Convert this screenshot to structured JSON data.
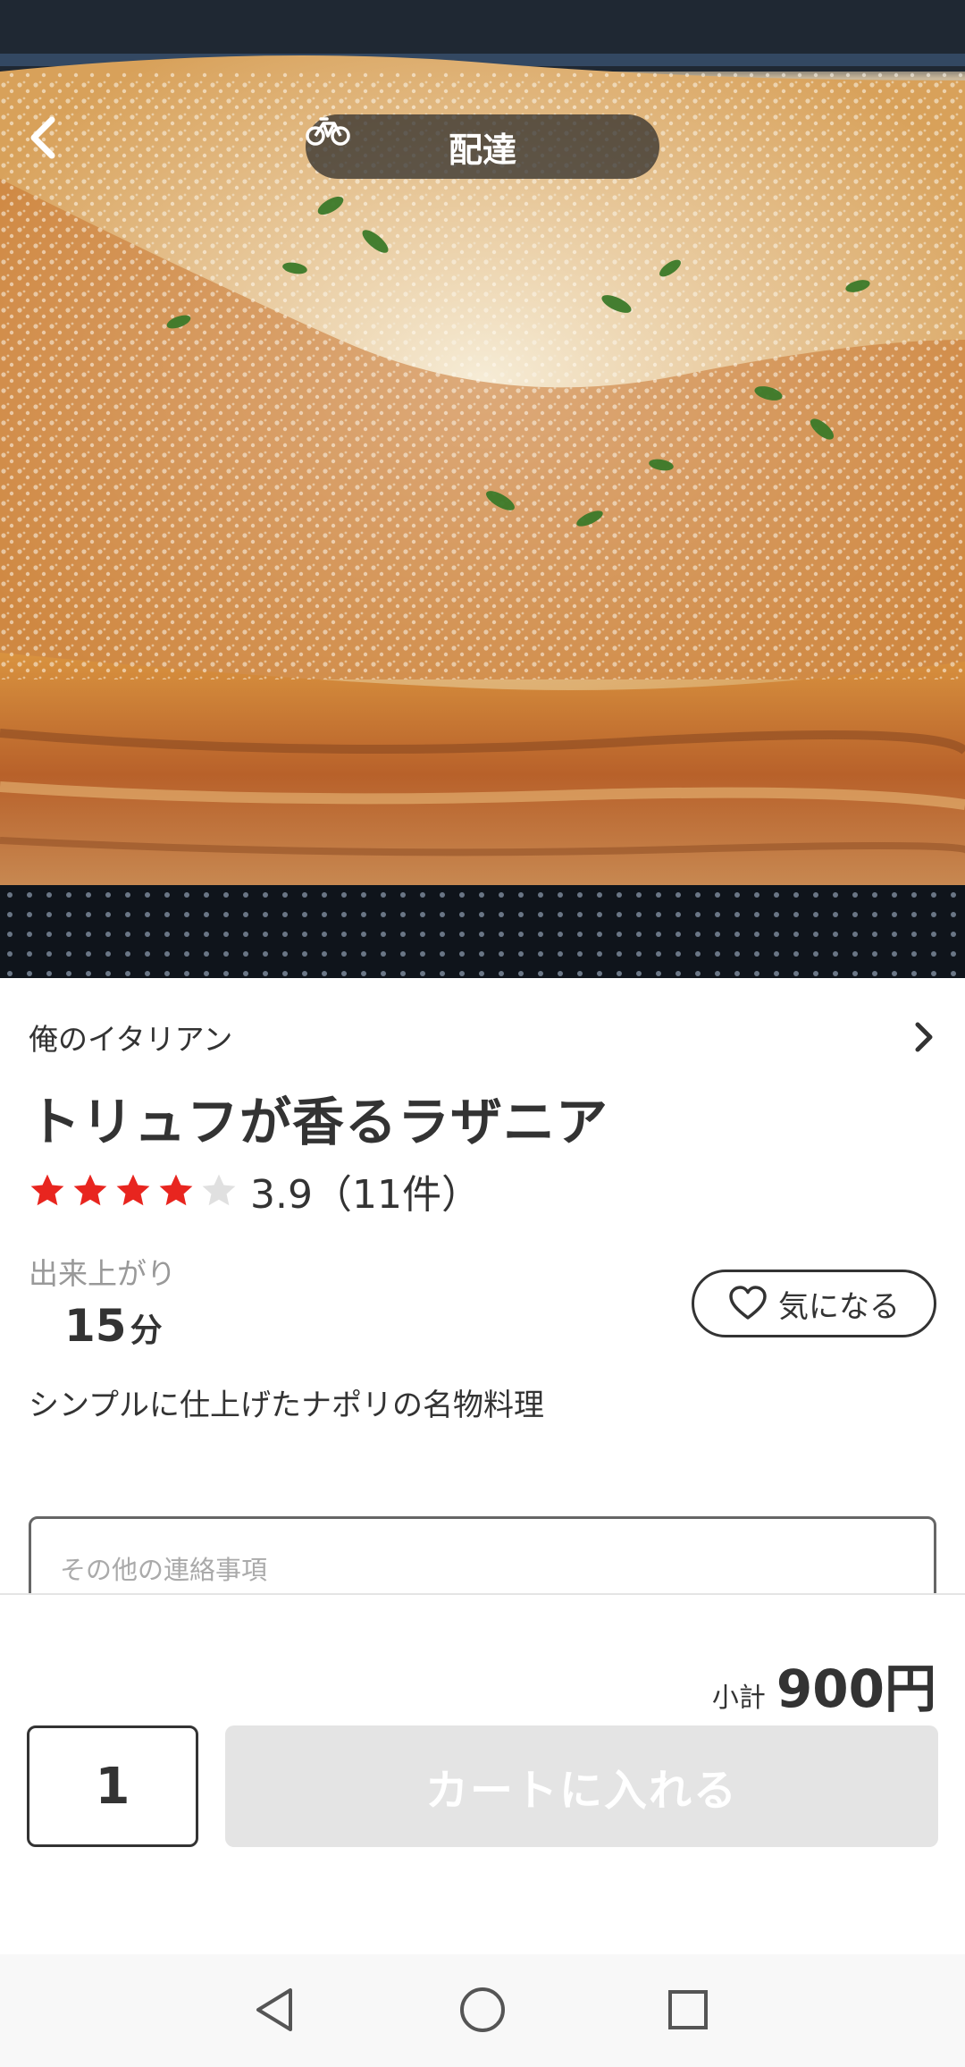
{
  "header": {
    "back_icon": "chevron-left-icon",
    "mode_icon": "bicycle-icon",
    "mode_label": "配達"
  },
  "product": {
    "shop_name": "俺のイタリアン",
    "shop_link_icon": "chevron-right-icon",
    "title": "トリュフが香るラザニア",
    "rating": {
      "value": 3.9,
      "stars_filled": 4,
      "stars_total": 5,
      "text": "3.9（11件）",
      "star_color": "#e8251f",
      "star_empty_color": "#e0e0e0"
    },
    "ready_label": "出来上がり",
    "ready_time": "15",
    "ready_unit": "分",
    "favorite_label": "気になる",
    "favorite_icon": "heart-outline-icon",
    "description": "シンプルに仕上げたナポリの名物料理"
  },
  "notes": {
    "placeholder": "その他の連絡事項"
  },
  "checkout": {
    "subtotal_label": "小計",
    "subtotal_value": "900円",
    "quantity": "1",
    "add_to_cart_label": "カートに入れる",
    "add_to_cart_bg": "#e4e4e4"
  },
  "system_nav": {
    "back": "nav-back-triangle-icon",
    "home": "nav-home-circle-icon",
    "recents": "nav-recents-square-icon"
  }
}
